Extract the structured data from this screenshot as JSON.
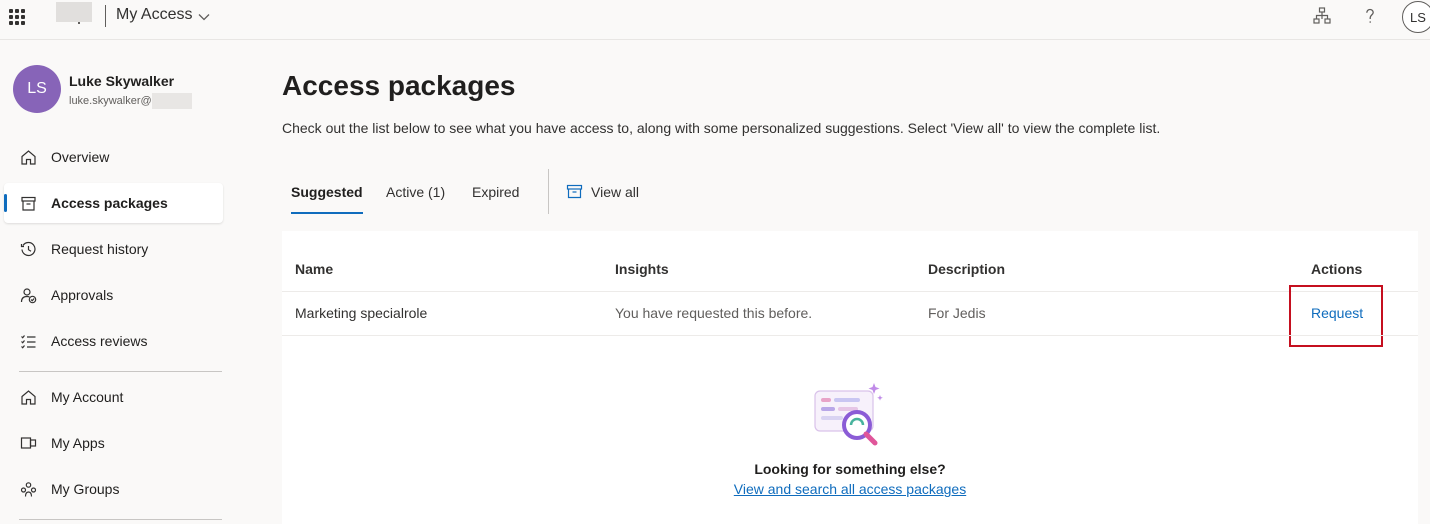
{
  "header": {
    "app_title": "My Access",
    "user_initials": "LS"
  },
  "sidebar": {
    "user": {
      "initials": "LS",
      "name": "Luke Skywalker",
      "email": "luke.skywalker@"
    },
    "items": [
      {
        "label": "Overview",
        "icon": "home-icon"
      },
      {
        "label": "Access packages",
        "icon": "archive-icon",
        "active": true
      },
      {
        "label": "Request history",
        "icon": "history-icon"
      },
      {
        "label": "Approvals",
        "icon": "person-check-icon"
      },
      {
        "label": "Access reviews",
        "icon": "checklist-icon"
      },
      {
        "label": "My Account",
        "icon": "home-icon"
      },
      {
        "label": "My Apps",
        "icon": "apps-icon"
      },
      {
        "label": "My Groups",
        "icon": "people-icon"
      }
    ]
  },
  "main": {
    "title": "Access packages",
    "description": "Check out the list below to see what you have access to, along with some personalized suggestions. Select 'View all' to view the complete list.",
    "tabs": [
      {
        "label": "Suggested",
        "selected": true
      },
      {
        "label": "Active (1)"
      },
      {
        "label": "Expired"
      }
    ],
    "view_all": "View all",
    "table": {
      "headers": [
        "Name",
        "Insights",
        "Description",
        "Actions"
      ],
      "rows": [
        {
          "name": "Marketing specialrole",
          "insights": "You have requested this before.",
          "description": "For Jedis",
          "action": "Request"
        }
      ]
    },
    "empty_state": {
      "heading": "Looking for something else?",
      "link": "View and search all access packages"
    }
  },
  "colors": {
    "accent": "#0f6cbd",
    "avatar": "#8764b8",
    "highlight": "#c50f1f"
  }
}
